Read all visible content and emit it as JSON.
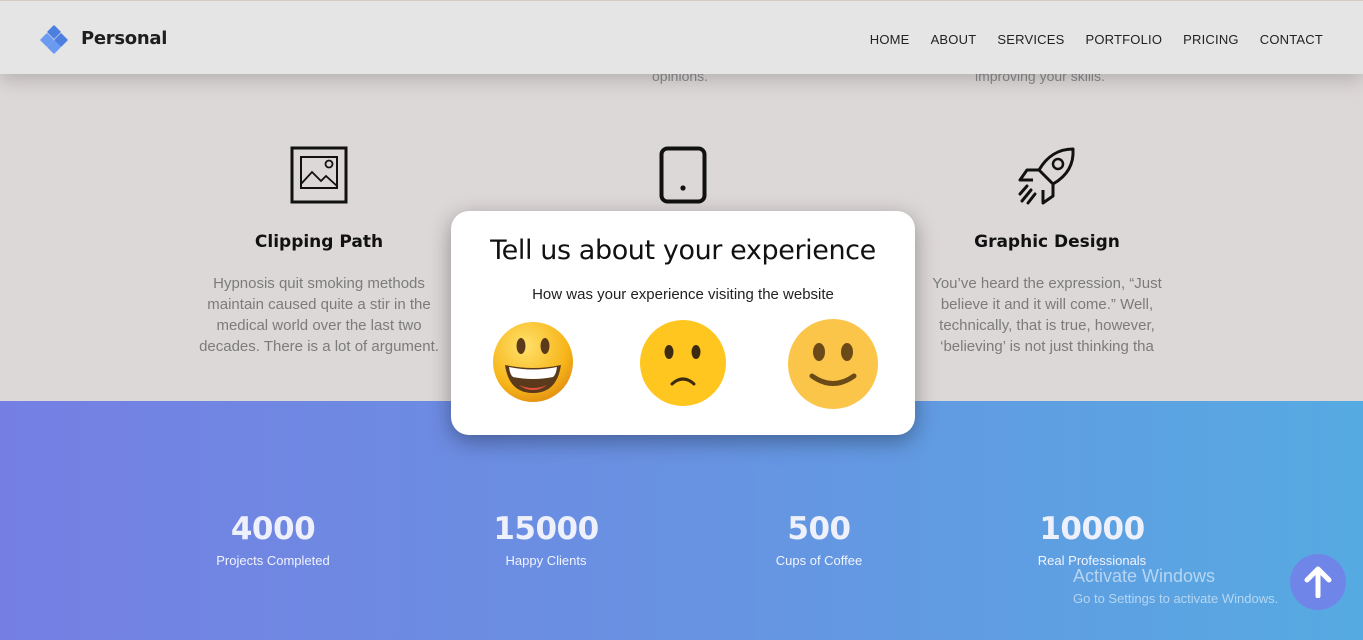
{
  "header": {
    "brand": "Personal",
    "nav": [
      "HOME",
      "ABOUT",
      "SERVICES",
      "PORTFOLIO",
      "PRICING",
      "CONTACT"
    ]
  },
  "services": {
    "peek_text": [
      "opinions.",
      "improving your skills."
    ],
    "items": [
      {
        "title": "Clipping Path",
        "icon": "image-frame-icon",
        "text": "Hypnosis quit smoking methods maintain caused quite a stir in the medical world over the last two decades. There is a lot of argument."
      },
      {
        "title": "",
        "icon": "tablet-icon",
        "text": ""
      },
      {
        "title": "Graphic Design",
        "icon": "rocket-icon",
        "text": "You’ve heard the expression, “Just believe it and it will come.” Well, technically, that is true, however, ‘believing’ is not just thinking tha"
      }
    ]
  },
  "stats": [
    {
      "value": "4000",
      "label": "Projects Completed"
    },
    {
      "value": "15000",
      "label": "Happy Clients"
    },
    {
      "value": "500",
      "label": "Cups of Coffee"
    },
    {
      "value": "10000",
      "label": "Real Professionals"
    }
  ],
  "modal": {
    "title": "Tell us about your experience",
    "subtitle": "How was your experience visiting the website",
    "options": [
      "grinning-face-icon",
      "frowning-face-icon",
      "smiling-face-icon"
    ]
  },
  "watermark": {
    "line1": "Activate Windows",
    "line2": "Go to Settings to activate Windows."
  },
  "colors": {
    "accent": "#5b8ee8",
    "stats_gradient_start": "#757fe3",
    "stats_gradient_end": "#56aae2"
  }
}
